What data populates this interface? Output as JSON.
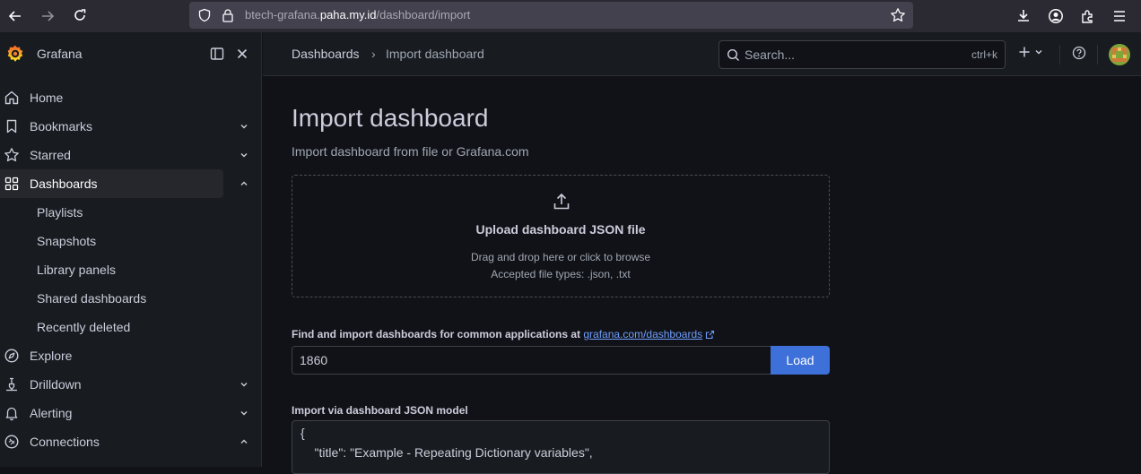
{
  "browser": {
    "url_prefix": "btech-grafana.",
    "url_domain": "paha.my.id",
    "url_path": "/dashboard/import"
  },
  "sidebar": {
    "brand": "Grafana",
    "items": [
      {
        "label": "Home"
      },
      {
        "label": "Bookmarks"
      },
      {
        "label": "Starred"
      },
      {
        "label": "Dashboards"
      },
      {
        "label": "Explore"
      },
      {
        "label": "Drilldown"
      },
      {
        "label": "Alerting"
      },
      {
        "label": "Connections"
      }
    ],
    "subitems": [
      {
        "label": "Playlists"
      },
      {
        "label": "Snapshots"
      },
      {
        "label": "Library panels"
      },
      {
        "label": "Shared dashboards"
      },
      {
        "label": "Recently deleted"
      }
    ]
  },
  "topbar": {
    "breadcrumb_root": "Dashboards",
    "breadcrumb_sep": "›",
    "breadcrumb_current": "Import dashboard",
    "search_placeholder": "Search...",
    "search_shortcut": "ctrl+k"
  },
  "main": {
    "title": "Import dashboard",
    "subtitle": "Import dashboard from file or Grafana.com",
    "upload": {
      "title": "Upload dashboard JSON file",
      "line1": "Drag and drop here or click to browse",
      "line2": "Accepted file types: .json, .txt"
    },
    "find_label": "Find and import dashboards for common applications at",
    "find_link": "grafana.com/dashboards",
    "dashboard_id_value": "1860",
    "load_label": "Load",
    "json_label": "Import via dashboard JSON model",
    "json_lines": [
      "{",
      "    \"title\": \"Example - Repeating Dictionary variables\","
    ]
  },
  "colors": {
    "accent": "#3d71d9",
    "link": "#6e9fff",
    "background": "#111217",
    "panel": "#181b1f"
  }
}
